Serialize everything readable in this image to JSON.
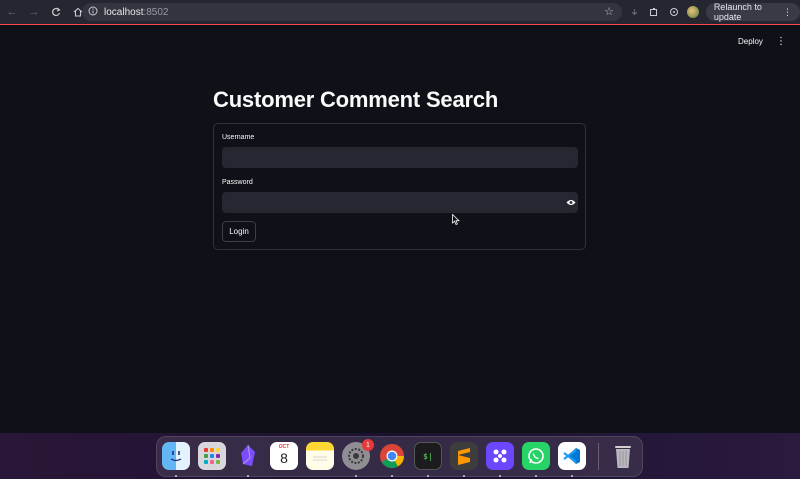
{
  "browser": {
    "url_host": "localhost",
    "url_port": ":8502",
    "relaunch_label": "Relaunch to update"
  },
  "app": {
    "deploy_label": "Deploy",
    "menu_glyph": "⋮",
    "title": "Customer Comment Search",
    "form": {
      "username_label": "Username",
      "username_value": "",
      "password_label": "Password",
      "password_value": "",
      "login_label": "Login"
    }
  },
  "dock": {
    "calendar_month": "OCT",
    "calendar_day": "8",
    "settings_badge": "1",
    "terminal_glyph": "$|",
    "items": [
      "finder-icon",
      "launchpad-icon",
      "obsidian-icon",
      "calendar-icon",
      "notes-icon",
      "system-settings-icon",
      "chrome-icon",
      "terminal-icon",
      "sublime-text-icon",
      "slack-like-icon",
      "whatsapp-icon",
      "vscode-icon",
      "trash-icon"
    ]
  },
  "colors": {
    "background": "#0e1117",
    "input_bg": "#262730",
    "accent_red": "#ff4b4b"
  }
}
